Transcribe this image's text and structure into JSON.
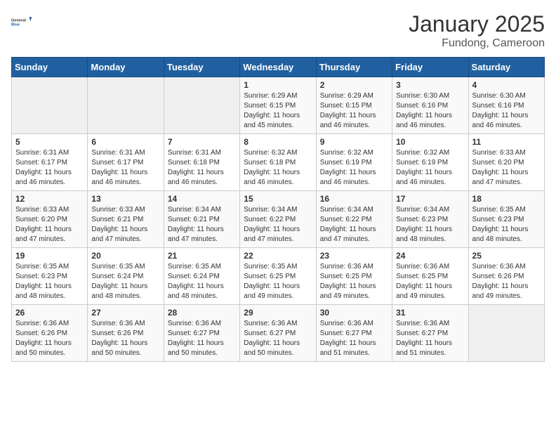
{
  "header": {
    "logo_general": "General",
    "logo_blue": "Blue",
    "title": "January 2025",
    "subtitle": "Fundong, Cameroon"
  },
  "days_of_week": [
    "Sunday",
    "Monday",
    "Tuesday",
    "Wednesday",
    "Thursday",
    "Friday",
    "Saturday"
  ],
  "weeks": [
    [
      {
        "day": "",
        "info": ""
      },
      {
        "day": "",
        "info": ""
      },
      {
        "day": "",
        "info": ""
      },
      {
        "day": "1",
        "info": "Sunrise: 6:29 AM\nSunset: 6:15 PM\nDaylight: 11 hours and 45 minutes."
      },
      {
        "day": "2",
        "info": "Sunrise: 6:29 AM\nSunset: 6:15 PM\nDaylight: 11 hours and 46 minutes."
      },
      {
        "day": "3",
        "info": "Sunrise: 6:30 AM\nSunset: 6:16 PM\nDaylight: 11 hours and 46 minutes."
      },
      {
        "day": "4",
        "info": "Sunrise: 6:30 AM\nSunset: 6:16 PM\nDaylight: 11 hours and 46 minutes."
      }
    ],
    [
      {
        "day": "5",
        "info": "Sunrise: 6:31 AM\nSunset: 6:17 PM\nDaylight: 11 hours and 46 minutes."
      },
      {
        "day": "6",
        "info": "Sunrise: 6:31 AM\nSunset: 6:17 PM\nDaylight: 11 hours and 46 minutes."
      },
      {
        "day": "7",
        "info": "Sunrise: 6:31 AM\nSunset: 6:18 PM\nDaylight: 11 hours and 46 minutes."
      },
      {
        "day": "8",
        "info": "Sunrise: 6:32 AM\nSunset: 6:18 PM\nDaylight: 11 hours and 46 minutes."
      },
      {
        "day": "9",
        "info": "Sunrise: 6:32 AM\nSunset: 6:19 PM\nDaylight: 11 hours and 46 minutes."
      },
      {
        "day": "10",
        "info": "Sunrise: 6:32 AM\nSunset: 6:19 PM\nDaylight: 11 hours and 46 minutes."
      },
      {
        "day": "11",
        "info": "Sunrise: 6:33 AM\nSunset: 6:20 PM\nDaylight: 11 hours and 47 minutes."
      }
    ],
    [
      {
        "day": "12",
        "info": "Sunrise: 6:33 AM\nSunset: 6:20 PM\nDaylight: 11 hours and 47 minutes."
      },
      {
        "day": "13",
        "info": "Sunrise: 6:33 AM\nSunset: 6:21 PM\nDaylight: 11 hours and 47 minutes."
      },
      {
        "day": "14",
        "info": "Sunrise: 6:34 AM\nSunset: 6:21 PM\nDaylight: 11 hours and 47 minutes."
      },
      {
        "day": "15",
        "info": "Sunrise: 6:34 AM\nSunset: 6:22 PM\nDaylight: 11 hours and 47 minutes."
      },
      {
        "day": "16",
        "info": "Sunrise: 6:34 AM\nSunset: 6:22 PM\nDaylight: 11 hours and 47 minutes."
      },
      {
        "day": "17",
        "info": "Sunrise: 6:34 AM\nSunset: 6:23 PM\nDaylight: 11 hours and 48 minutes."
      },
      {
        "day": "18",
        "info": "Sunrise: 6:35 AM\nSunset: 6:23 PM\nDaylight: 11 hours and 48 minutes."
      }
    ],
    [
      {
        "day": "19",
        "info": "Sunrise: 6:35 AM\nSunset: 6:23 PM\nDaylight: 11 hours and 48 minutes."
      },
      {
        "day": "20",
        "info": "Sunrise: 6:35 AM\nSunset: 6:24 PM\nDaylight: 11 hours and 48 minutes."
      },
      {
        "day": "21",
        "info": "Sunrise: 6:35 AM\nSunset: 6:24 PM\nDaylight: 11 hours and 48 minutes."
      },
      {
        "day": "22",
        "info": "Sunrise: 6:35 AM\nSunset: 6:25 PM\nDaylight: 11 hours and 49 minutes."
      },
      {
        "day": "23",
        "info": "Sunrise: 6:36 AM\nSunset: 6:25 PM\nDaylight: 11 hours and 49 minutes."
      },
      {
        "day": "24",
        "info": "Sunrise: 6:36 AM\nSunset: 6:25 PM\nDaylight: 11 hours and 49 minutes."
      },
      {
        "day": "25",
        "info": "Sunrise: 6:36 AM\nSunset: 6:26 PM\nDaylight: 11 hours and 49 minutes."
      }
    ],
    [
      {
        "day": "26",
        "info": "Sunrise: 6:36 AM\nSunset: 6:26 PM\nDaylight: 11 hours and 50 minutes."
      },
      {
        "day": "27",
        "info": "Sunrise: 6:36 AM\nSunset: 6:26 PM\nDaylight: 11 hours and 50 minutes."
      },
      {
        "day": "28",
        "info": "Sunrise: 6:36 AM\nSunset: 6:27 PM\nDaylight: 11 hours and 50 minutes."
      },
      {
        "day": "29",
        "info": "Sunrise: 6:36 AM\nSunset: 6:27 PM\nDaylight: 11 hours and 50 minutes."
      },
      {
        "day": "30",
        "info": "Sunrise: 6:36 AM\nSunset: 6:27 PM\nDaylight: 11 hours and 51 minutes."
      },
      {
        "day": "31",
        "info": "Sunrise: 6:36 AM\nSunset: 6:27 PM\nDaylight: 11 hours and 51 minutes."
      },
      {
        "day": "",
        "info": ""
      }
    ]
  ]
}
